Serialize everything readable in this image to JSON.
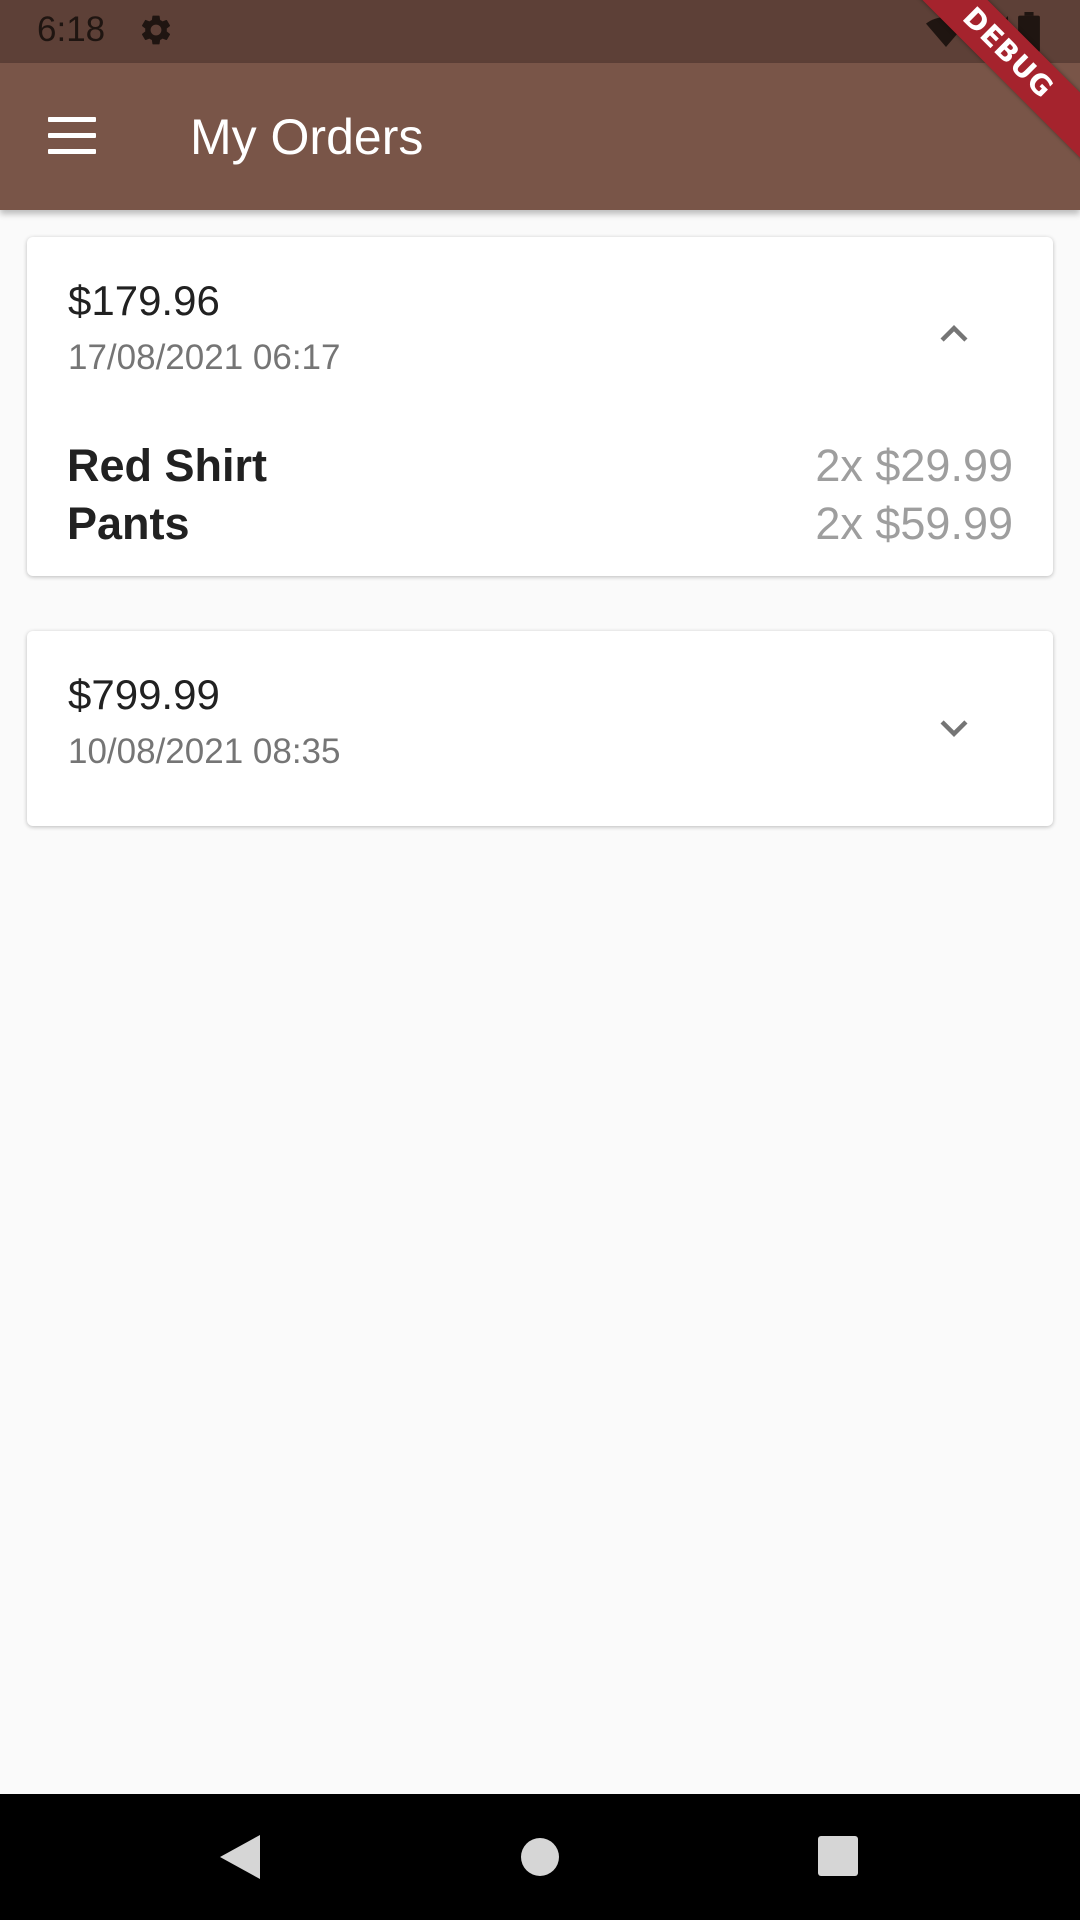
{
  "status_bar": {
    "time": "6:18",
    "icons": [
      "gear-icon",
      "wifi-icon",
      "signal-icon",
      "battery-icon"
    ]
  },
  "app_bar": {
    "title": "My Orders",
    "menu_icon": "menu-icon",
    "background": "#795548"
  },
  "debug_banner": "DEBUG",
  "orders": [
    {
      "amount": "$179.96",
      "date": "17/08/2021 06:17",
      "expanded": true,
      "items": [
        {
          "name": "Red Shirt",
          "qty": "2x $29.99"
        },
        {
          "name": "Pants",
          "qty": "2x $59.99"
        }
      ]
    },
    {
      "amount": "$799.99",
      "date": "10/08/2021 08:35",
      "expanded": false,
      "items": []
    }
  ],
  "nav_bar": {
    "buttons": [
      "back-icon",
      "home-icon",
      "recents-icon"
    ]
  },
  "colors": {
    "status_bar": "#5d4037",
    "app_bar": "#795548",
    "debug": "#a5232d",
    "background": "#fafafa"
  }
}
